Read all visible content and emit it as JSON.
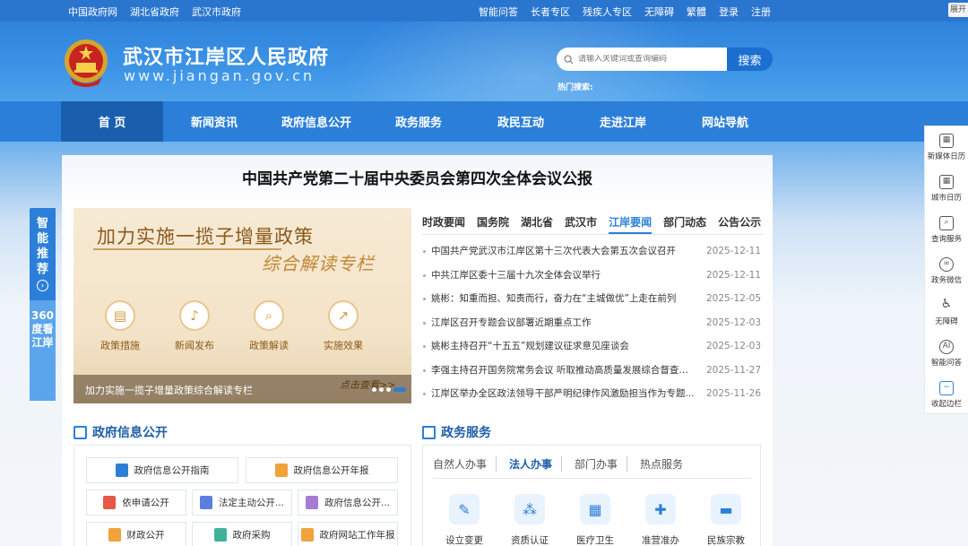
{
  "topbar": {
    "links_left": [
      "中国政府网",
      "湖北省政府",
      "武汉市政府"
    ],
    "links_right": [
      "智能问答",
      "长者专区",
      "残疾人专区",
      "无障碍",
      "繁體",
      "登录",
      "注册"
    ],
    "corner": "展开"
  },
  "header": {
    "title": "武汉市江岸区人民政府",
    "url": "www.jiangan.gov.cn",
    "search_placeholder": "请输入关键词或查询编码",
    "search_button": "搜索",
    "hot_label": "热门搜索:"
  },
  "nav": {
    "items": [
      "首 页",
      "新闻资讯",
      "政府信息公开",
      "政务服务",
      "政民互动",
      "走进江岸",
      "网站导航"
    ],
    "active_index": 0
  },
  "headline": "中国共产党第二十届中央委员会第四次全体会议公报",
  "banner": {
    "title1": "加力实施一揽子增量政策",
    "title2": "综合解读专栏",
    "icons": [
      "政策措施",
      "新闻发布",
      "政策解读",
      "实施效果"
    ],
    "caption": "加力实施一揽子增量政策综合解读专栏",
    "click_text": "点击查看>>"
  },
  "news": {
    "tabs": [
      "时政要闻",
      "国务院",
      "湖北省",
      "武汉市",
      "江岸要闻",
      "部门动态",
      "公告公示"
    ],
    "active_tab": 4,
    "items": [
      {
        "title": "中国共产党武汉市江岸区第十三次代表大会第五次会议召开",
        "date": "2025-12-11"
      },
      {
        "title": "中共江岸区委十三届十九次全体会议举行",
        "date": "2025-12-11"
      },
      {
        "title": "姚彬：知重而担、知责而行，奋力在“主城做优”上走在前列",
        "date": "2025-12-05"
      },
      {
        "title": "江岸区召开专题会议部署近期重点工作",
        "date": "2025-12-03"
      },
      {
        "title": "姚彬主持召开“十五五”规划建议征求意见座谈会",
        "date": "2025-12-03"
      },
      {
        "title": "李强主持召开国务院常务会议 听取推动高质量发展综合督查情...",
        "date": "2025-11-27"
      },
      {
        "title": "江岸区举办全区政法领导干部严明纪律作风激励担当作为专题...",
        "date": "2025-11-26"
      }
    ]
  },
  "gov_info": {
    "heading": "政府信息公开",
    "row1": [
      "政府信息公开指南",
      "政府信息公开年报"
    ],
    "row2": [
      "依申请公开",
      "法定主动公开...",
      "政府信息公开..."
    ],
    "row3": [
      "财政公开",
      "政府采购",
      "政府网站工作年报"
    ]
  },
  "services": {
    "heading": "政务服务",
    "tabs": [
      "自然人办事",
      "法人办事",
      "部门办事",
      "热点服务"
    ],
    "active_tab": 1,
    "items": [
      "设立变更",
      "资质认证",
      "医疗卫生",
      "准营准办",
      "民族宗教"
    ]
  },
  "float_left": {
    "top_text": "智能推荐",
    "bottom_text": "360度看江岸"
  },
  "float_right": {
    "items": [
      "新媒体日历",
      "城市日历",
      "查询服务",
      "政务微信",
      "无障碍",
      "智能问答",
      "收起边栏"
    ]
  },
  "colors": {
    "primary": "#2b7fd9",
    "nav_active": "#1a5fae",
    "heading_blue": "#1e5ea8",
    "banner_gold": "#8a5a1c"
  }
}
